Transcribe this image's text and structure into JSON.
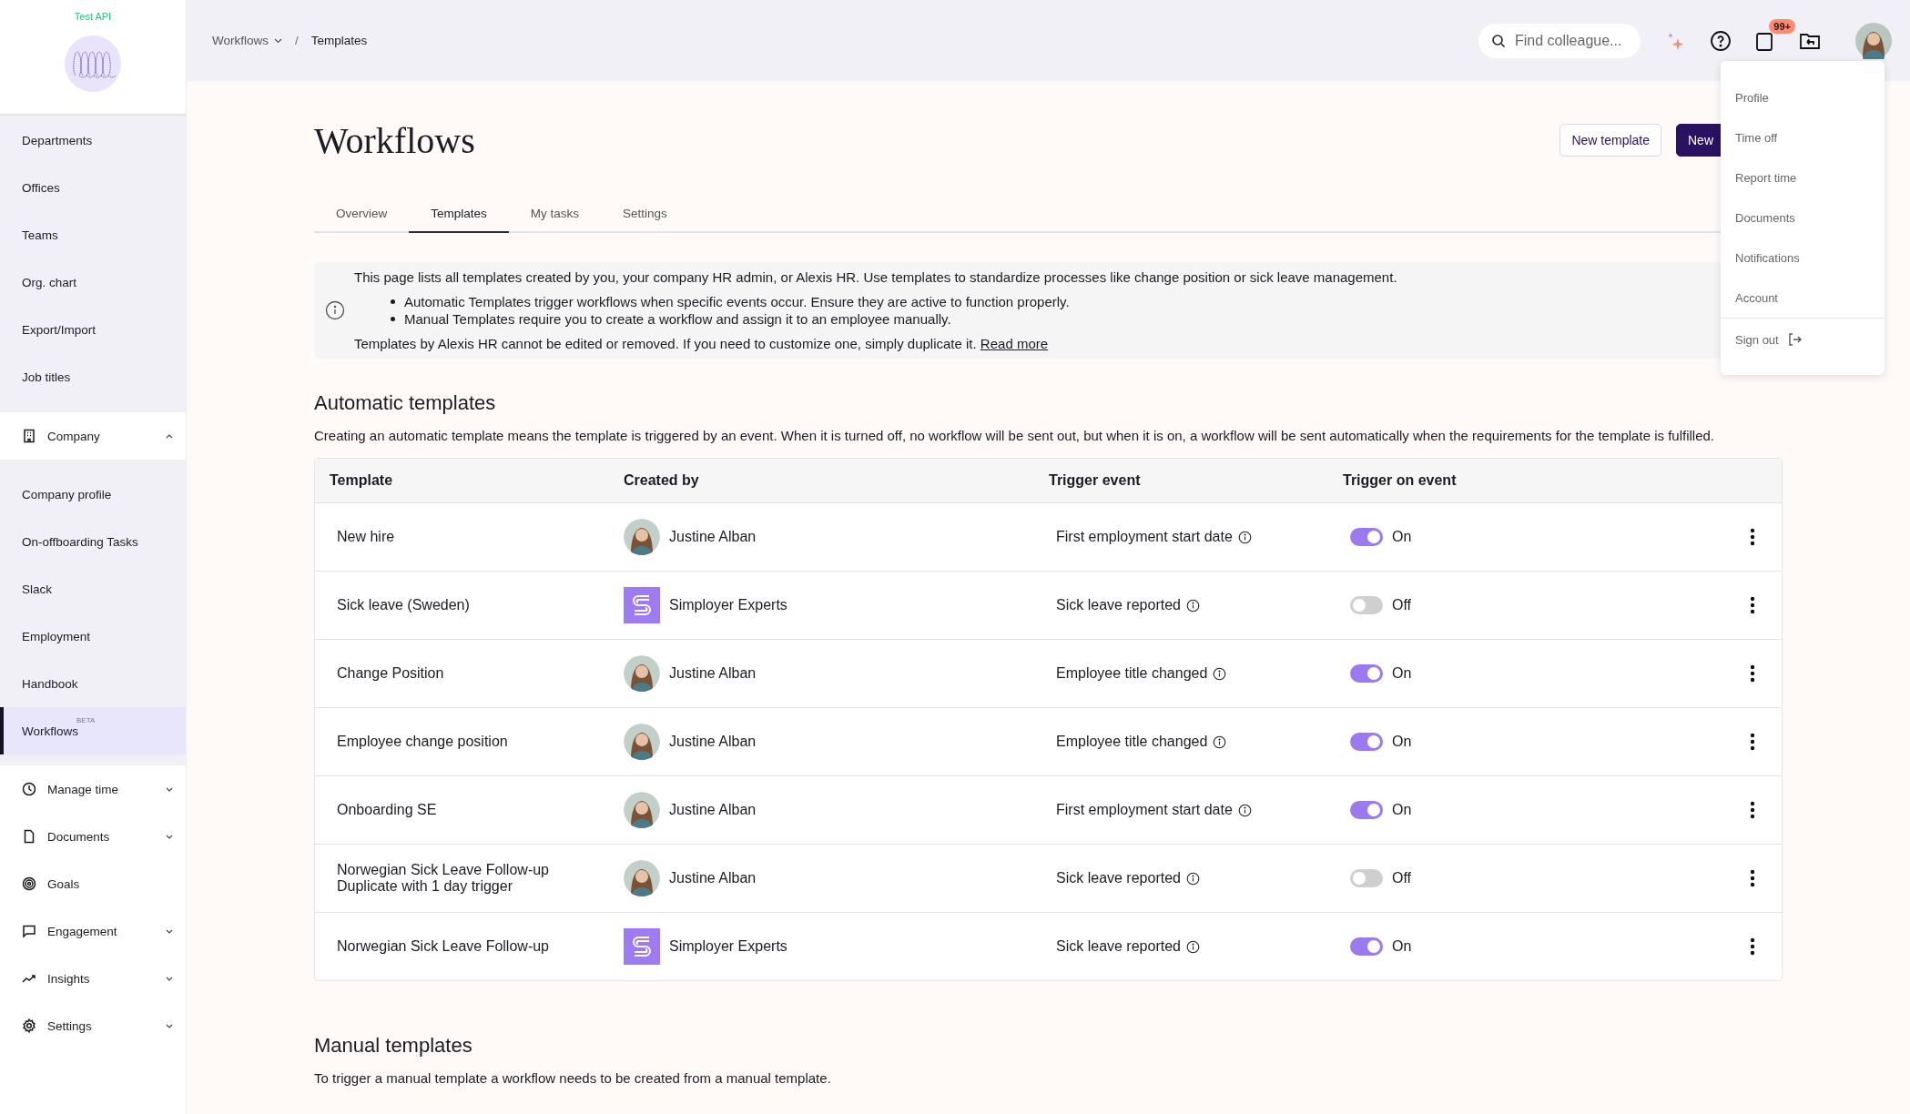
{
  "sidebar": {
    "org_name": "Test API",
    "top_items": [
      {
        "label": "Departments",
        "selected": false
      },
      {
        "label": "Offices",
        "selected": false
      },
      {
        "label": "Teams",
        "selected": false
      },
      {
        "label": "Org. chart",
        "selected": false
      },
      {
        "label": "Export/Import",
        "selected": false
      },
      {
        "label": "Job titles",
        "selected": false
      }
    ],
    "sections": [
      {
        "label": "Company",
        "kind": "building",
        "expanded": true,
        "children": [
          {
            "label": "Company profile",
            "selected": false
          },
          {
            "label": "On-offboarding Tasks",
            "selected": false
          },
          {
            "label": "Slack",
            "selected": false
          },
          {
            "label": "Employment",
            "selected": false
          },
          {
            "label": "Handbook",
            "selected": false
          },
          {
            "label": "Workflows",
            "badge": "BETA",
            "selected": true
          }
        ]
      },
      {
        "label": "Manage time",
        "kind": "clock",
        "expanded": false
      },
      {
        "label": "Documents",
        "kind": "file",
        "expanded": false
      },
      {
        "label": "Goals",
        "kind": "target"
      },
      {
        "label": "Engagement",
        "kind": "chat",
        "expanded": false
      },
      {
        "label": "Insights",
        "kind": "trend",
        "expanded": false
      },
      {
        "label": "Settings",
        "kind": "gear",
        "expanded": false
      }
    ]
  },
  "breadcrumb_separator": "/",
  "breadcrumb": [
    {
      "label": "Workflows",
      "dropdown": true
    },
    {
      "label": "Templates",
      "dropdown": false
    }
  ],
  "search": {
    "placeholder": "Find colleague..."
  },
  "notifications_badge": "99+",
  "page_title": "Workflows",
  "header_buttons": [
    {
      "label": "New template",
      "kind": "secondary"
    },
    {
      "label": "New",
      "kind": "primary"
    }
  ],
  "tabs": [
    {
      "label": "Overview",
      "selected": false
    },
    {
      "label": "Templates",
      "selected": true
    },
    {
      "label": "My tasks",
      "selected": false
    },
    {
      "label": "Settings",
      "selected": false
    }
  ],
  "info": {
    "intro": "This page lists all templates created by you, your company HR admin, or Alexis HR. Use templates to standardize processes like change position or sick leave management.",
    "bullets": [
      "Automatic Templates trigger workflows when specific events occur. Ensure they are active to function properly.",
      "Manual Templates require you to create a workflow and assign it to an employee manually."
    ],
    "note": "Templates by Alexis HR cannot be edited or removed. If you need to customize one, simply duplicate it.",
    "link": "Read more"
  },
  "automatic": {
    "title": "Automatic templates",
    "description": "Creating an automatic template means the template is triggered by an event. When it is turned off, no workflow will be sent out, but when it is on, a workflow will be sent automatically when the requirements for the template is fulfilled.",
    "columns": [
      "Template",
      "Created by",
      "Trigger event",
      "Trigger on event"
    ],
    "rows": [
      {
        "template": "New hire",
        "creator": "Justine Alban",
        "kind": "person",
        "trigger": "First employment start date",
        "on": true,
        "status": "On"
      },
      {
        "template": "Sick leave (Sweden)",
        "creator": "Simployer Experts",
        "kind": "company",
        "trigger": "Sick leave reported",
        "on": false,
        "status": "Off"
      },
      {
        "template": "Change Position",
        "creator": "Justine Alban",
        "kind": "person",
        "trigger": "Employee title changed",
        "on": true,
        "status": "On"
      },
      {
        "template": "Employee change position",
        "creator": "Justine Alban",
        "kind": "person",
        "trigger": "Employee title changed",
        "on": true,
        "status": "On"
      },
      {
        "template": "Onboarding SE",
        "creator": "Justine Alban",
        "kind": "person",
        "trigger": "First employment start date",
        "on": true,
        "status": "On"
      },
      {
        "template": "Norwegian Sick Leave Follow-up Duplicate with 1 day trigger",
        "creator": "Justine Alban",
        "kind": "person",
        "trigger": "Sick leave reported",
        "on": false,
        "status": "Off"
      },
      {
        "template": "Norwegian Sick Leave Follow-up",
        "creator": "Simployer Experts",
        "kind": "company",
        "trigger": "Sick leave reported",
        "on": true,
        "status": "On"
      }
    ]
  },
  "manual": {
    "title": "Manual templates",
    "description": "To trigger a manual template a workflow needs to be created from a manual template."
  },
  "user_menu": {
    "items": [
      "Profile",
      "Time off",
      "Report time",
      "Documents",
      "Notifications",
      "Account"
    ],
    "sign_out": "Sign out"
  }
}
